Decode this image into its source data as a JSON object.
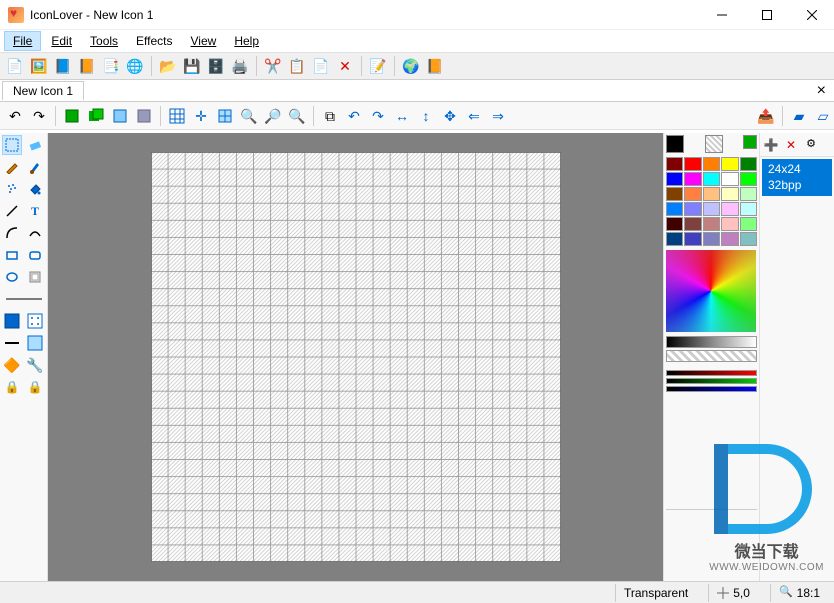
{
  "window": {
    "title": "IconLover - New Icon 1"
  },
  "menu": {
    "file": "File",
    "edit": "Edit",
    "tools": "Tools",
    "effects": "Effects",
    "view": "View",
    "help": "Help"
  },
  "tabs": {
    "doc1": "New Icon 1"
  },
  "status": {
    "transparent": "Transparent",
    "coords": "5,0",
    "zoom": "18:1"
  },
  "formats": {
    "size": "24x24",
    "depth": "32bpp"
  },
  "palette": [
    "#800000",
    "#ff0000",
    "#ff8000",
    "#ffff00",
    "#008000",
    "#0000ff",
    "#ff00ff",
    "#00ffff",
    "#ffffff",
    "#00ff00",
    "#804000",
    "#ff8040",
    "#ffc080",
    "#ffffc0",
    "#c0ffc0",
    "#0080ff",
    "#8080ff",
    "#c0c0ff",
    "#ffc0ff",
    "#c0ffff",
    "#400000",
    "#804040",
    "#c08080",
    "#ffc0c0",
    "#80ff80",
    "#004080",
    "#4040c0",
    "#8080c0",
    "#c080c0",
    "#80c0c0"
  ],
  "current_colors": {
    "fg": "#000000",
    "bg_pattern": "transparent",
    "aux": "#008000"
  },
  "watermark": {
    "text_cn": "微当下载",
    "url": "WWW.WEIDOWN.COM"
  }
}
